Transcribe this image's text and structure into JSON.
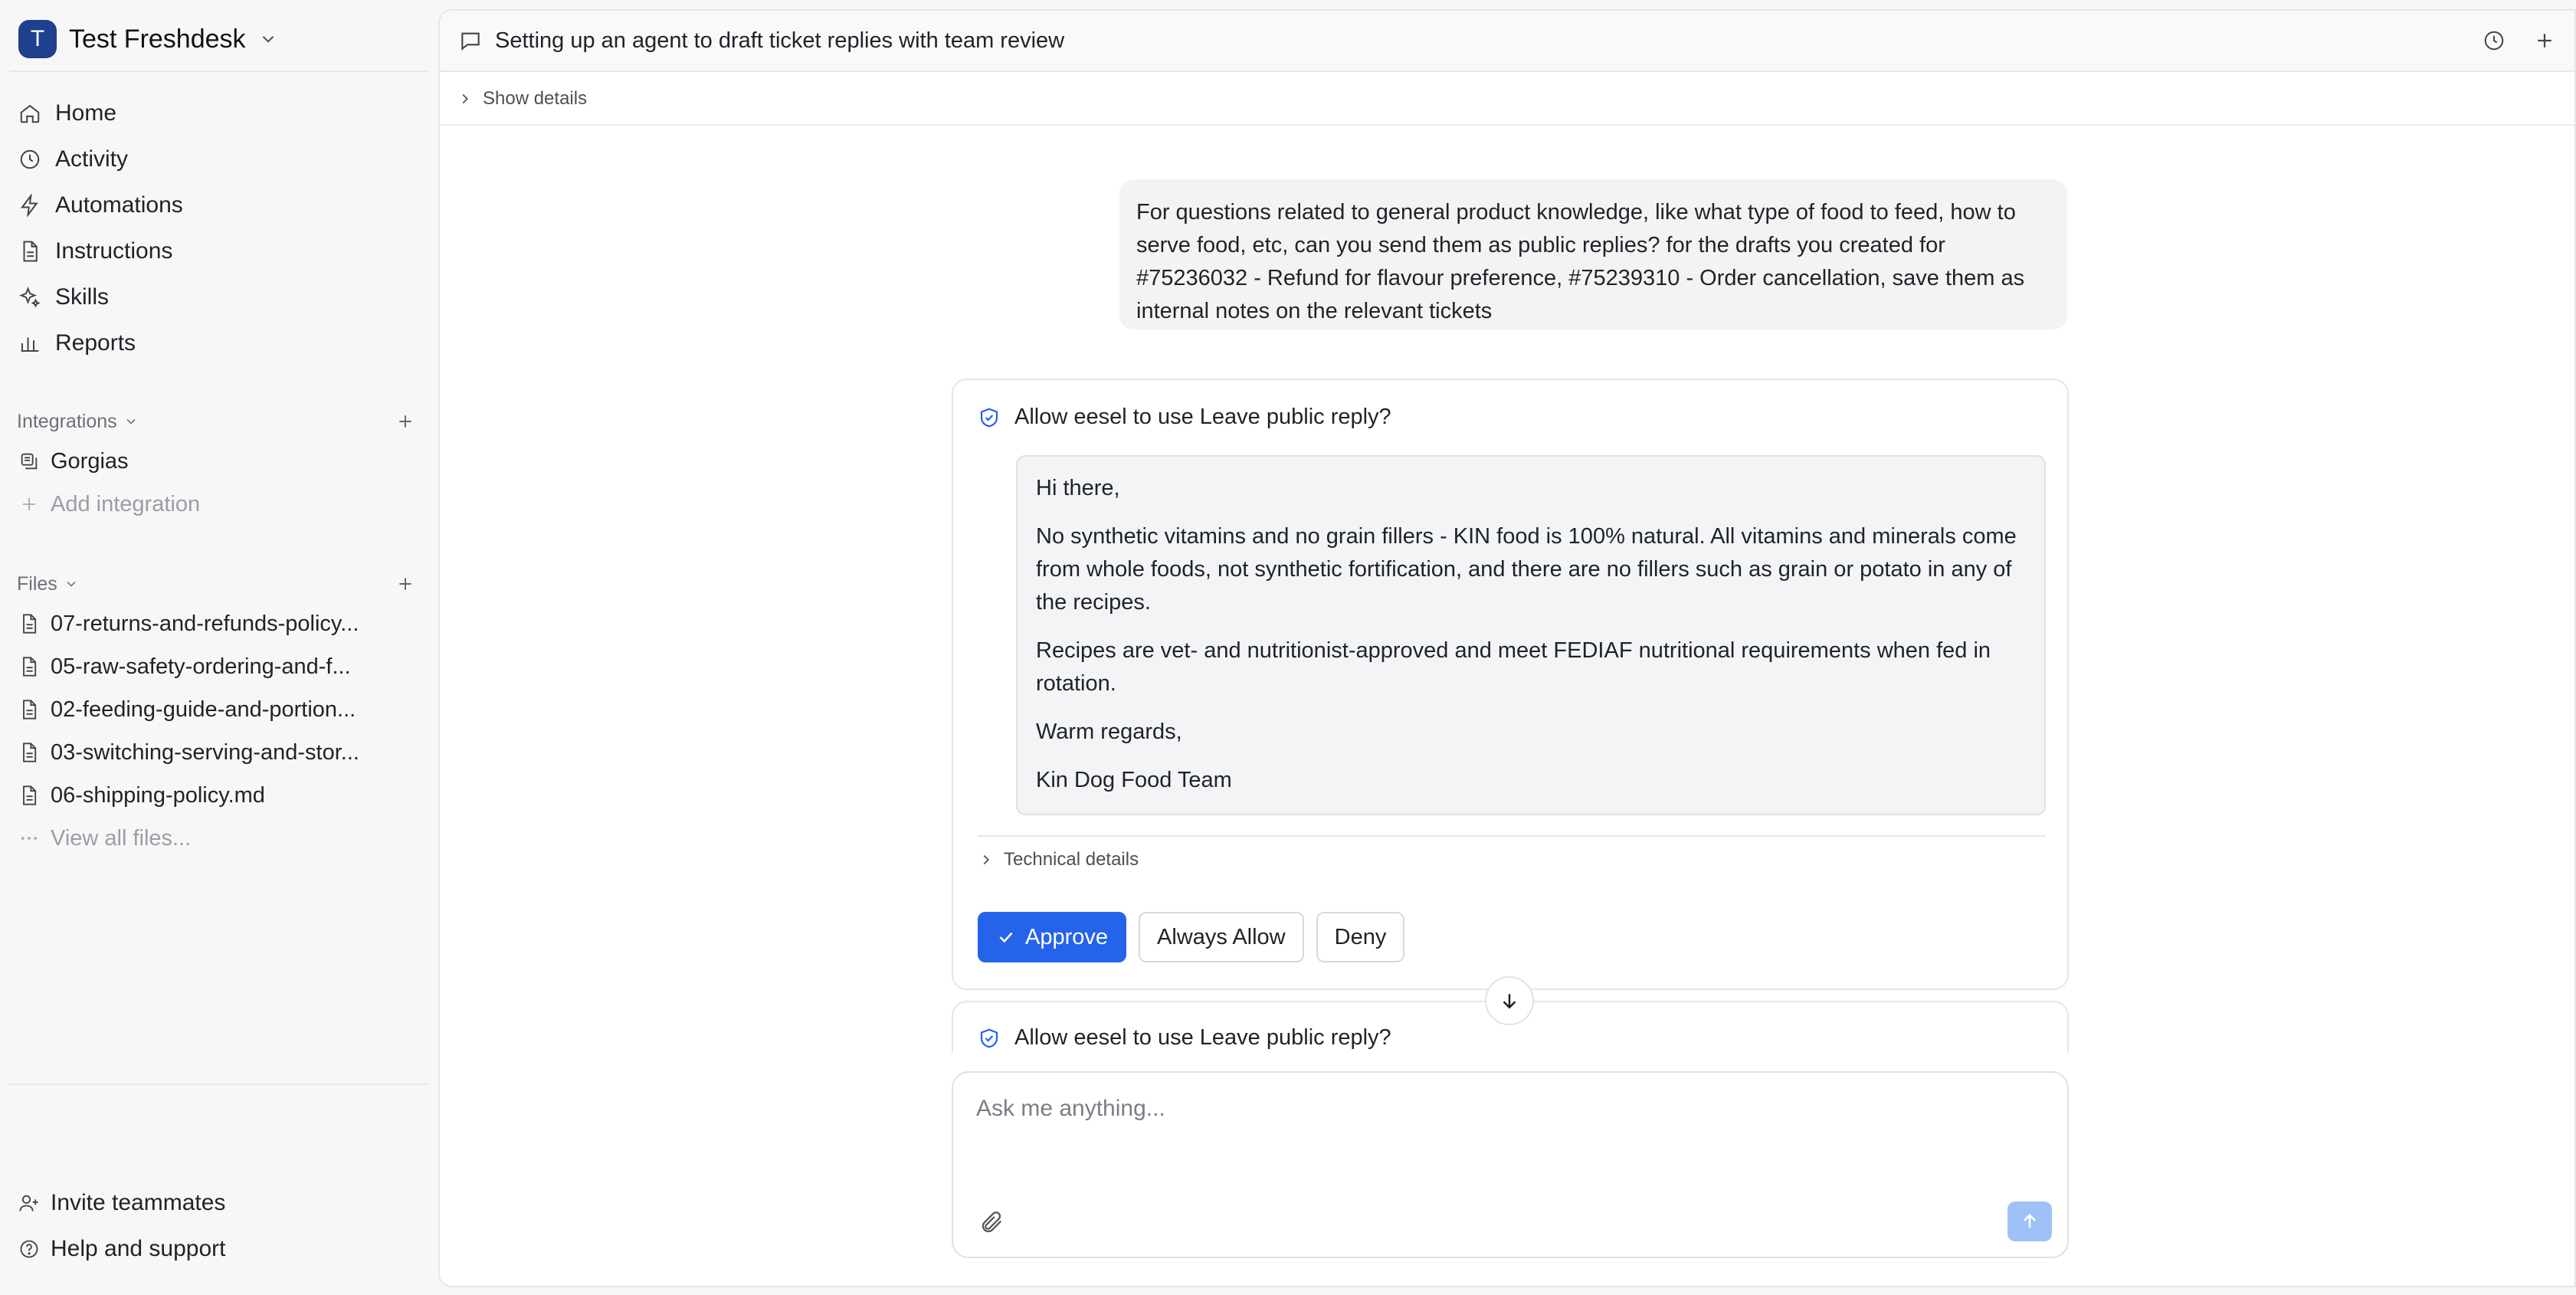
{
  "workspace": {
    "initial": "T",
    "name": "Test Freshdesk"
  },
  "nav": [
    {
      "label": "Home",
      "icon": "home-icon"
    },
    {
      "label": "Activity",
      "icon": "clock-icon"
    },
    {
      "label": "Automations",
      "icon": "bolt-icon"
    },
    {
      "label": "Instructions",
      "icon": "document-icon"
    },
    {
      "label": "Skills",
      "icon": "sparkles-icon"
    },
    {
      "label": "Reports",
      "icon": "bar-chart-icon"
    }
  ],
  "integrations": {
    "heading": "Integrations",
    "items": [
      {
        "label": "Gorgias",
        "icon": "integration-icon"
      }
    ],
    "add_label": "Add integration"
  },
  "files": {
    "heading": "Files",
    "items": [
      "07-returns-and-refunds-policy...",
      "05-raw-safety-ordering-and-f...",
      "02-feeding-guide-and-portion...",
      "03-switching-serving-and-stor...",
      "06-shipping-policy.md"
    ],
    "view_all": "View all files..."
  },
  "bottom": {
    "invite": "Invite teammates",
    "help": "Help and support"
  },
  "chat": {
    "title": "Setting up an agent to draft ticket replies with team review",
    "show_details": "Show details",
    "user_message": "For questions related to general product knowledge, like what type of food to feed, how to serve food, etc, can you send them as public replies? for the drafts you created for #75236032 - Refund for flavour preference, #75239310 - Order cancellation, save them as internal notes on the relevant tickets",
    "approval": {
      "prompt": "Allow eesel to use Leave public reply?",
      "draft": {
        "greeting": "Hi there,",
        "para1": "No synthetic vitamins and no grain fillers - KIN food is 100% natural. All vitamins and minerals come from whole foods, not synthetic fortification, and there are no fillers such as grain or potato in any of the recipes.",
        "para2": "Recipes are vet- and nutritionist-approved and meet FEDIAF nutritional requirements when fed in rotation.",
        "signoff": "Warm regards,",
        "signature": "Kin Dog Food Team"
      },
      "technical_details": "Technical details",
      "approve": "Approve",
      "always_allow": "Always Allow",
      "deny": "Deny"
    },
    "approval2_prompt": "Allow eesel to use Leave public reply?",
    "composer_placeholder": "Ask me anything..."
  },
  "colors": {
    "accent": "#2563eb",
    "workspace_avatar": "#1f3f8f",
    "send_disabled": "#9ec1f7"
  }
}
